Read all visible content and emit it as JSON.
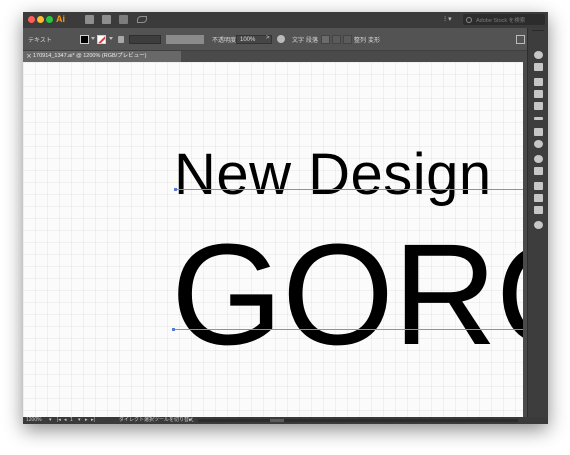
{
  "titlebar": {
    "app_logo": "Ai",
    "workspace_menu": "⁝ ▾",
    "stock_search_placeholder": "Adobe Stock を検索",
    "icons": [
      "bridge-icon",
      "stock-icon",
      "arrange-documents-icon",
      "gpu-feather-icon"
    ]
  },
  "controlbar": {
    "selection_label": "テキスト",
    "opacity_label": "不透明度",
    "opacity_value": "100%",
    "opacity_arrow": ">",
    "character_label": "文字",
    "paragraph_label": "段落",
    "align_label": "整列",
    "transform_label": "変形"
  },
  "document_tab": {
    "close": "×",
    "title": "170914_1347.ai* @ 1200% (RGB/プレビュー)"
  },
  "canvas": {
    "line1": "New Design",
    "line2": "GORO",
    "guide_color": "#7b93d6",
    "grid": true
  },
  "statusbar": {
    "zoom": "1200%",
    "artboard_number": "1",
    "tool_status": "ダイレクト選択ツールを切り替え"
  },
  "colors": {
    "app_chrome": "#535353",
    "titlebar": "#3b3b3b",
    "accent_logo": "#ff9a00",
    "fill": "#000000",
    "stroke_none": "#e53a3a"
  }
}
